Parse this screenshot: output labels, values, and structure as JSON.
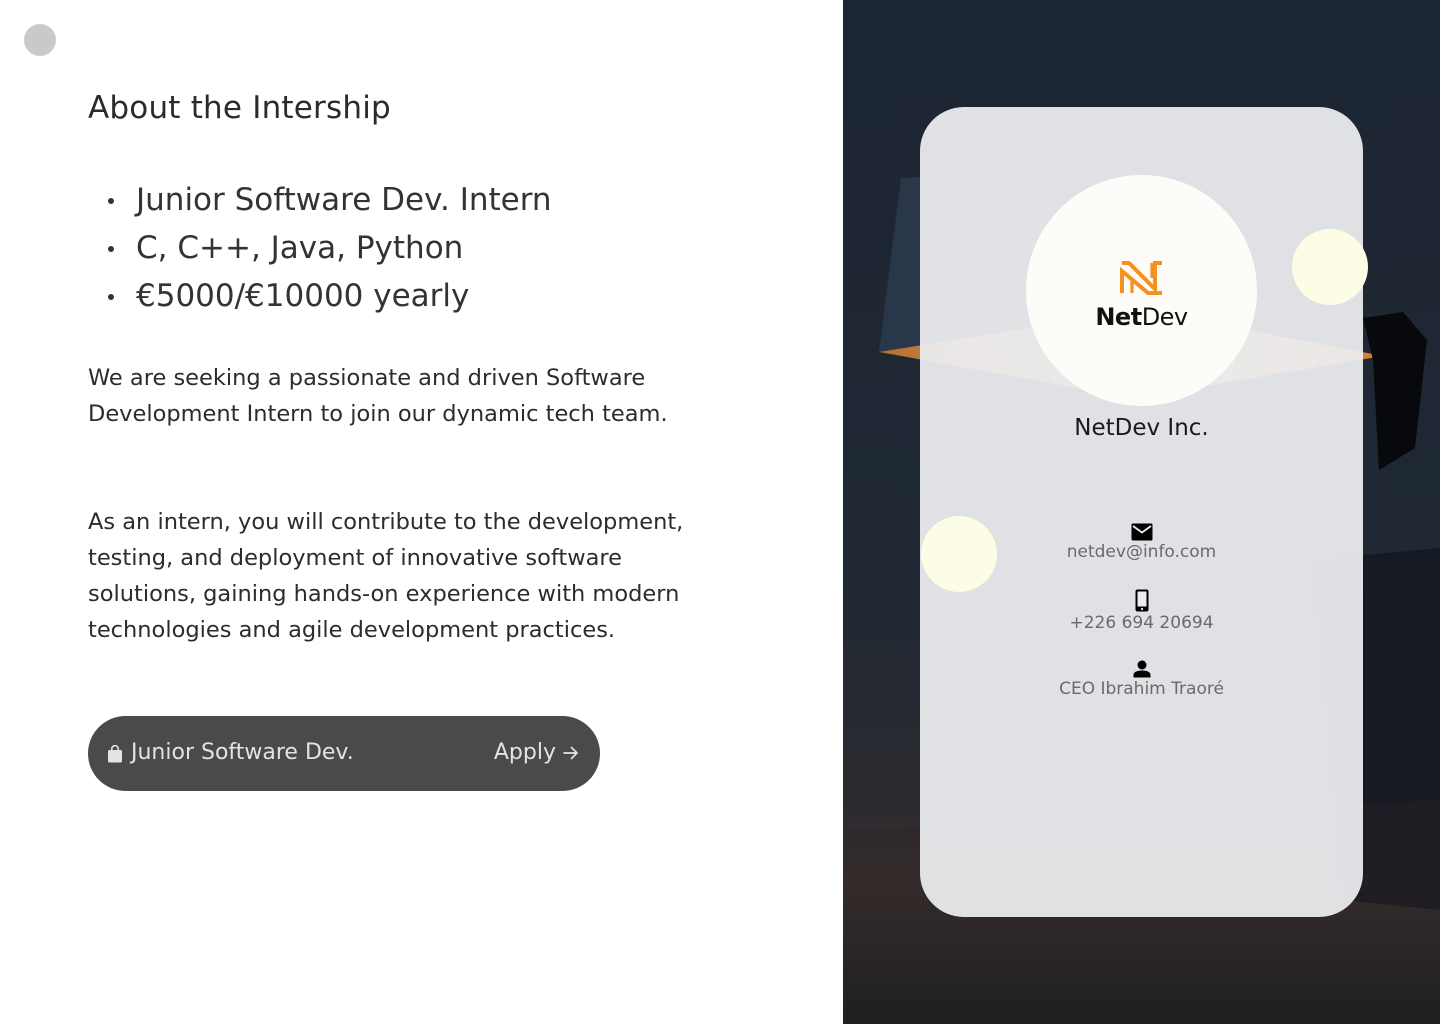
{
  "menu": {
    "icon": "menu-dot"
  },
  "about": {
    "title": "About the Intership",
    "highlights": [
      "Junior Software Dev. Intern",
      "C, C++, Java, Python",
      "€5000/€10000 yearly"
    ],
    "paragraphs": [
      "We are seeking a passionate and driven Software Development Intern to join our dynamic tech team.",
      "As an intern, you will contribute to the development, testing, and deployment of innovative software solutions, gaining hands-on experience with modern technologies and agile development practices."
    ]
  },
  "apply_bar": {
    "icon": "shopping-bag-icon",
    "role": "Junior Software Dev.",
    "action": "Apply",
    "action_icon": "arrow-right-icon"
  },
  "company": {
    "logo": {
      "mark": "N",
      "word_strong": "Net",
      "word_light": "Dev"
    },
    "name": "NetDev Inc.",
    "email": "netdev@info.com",
    "phone": "+226 694 20694",
    "ceo": "CEO Ibrahim Traoré"
  },
  "colors": {
    "accent": "#f3921f",
    "button_bg": "#4a4a4a",
    "card_bg": "#ecedf0",
    "orb": "#fdfde6",
    "panel_bg": "#1f2833"
  }
}
